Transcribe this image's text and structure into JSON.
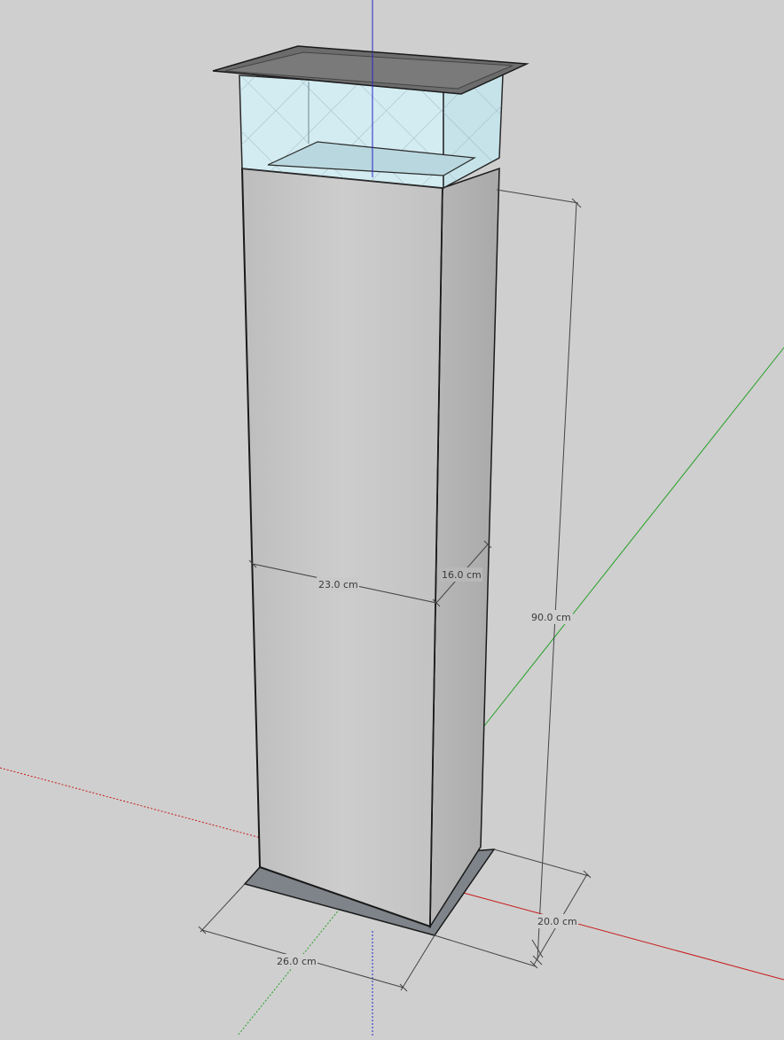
{
  "scene": {
    "background": "#cfcfcf",
    "axis_colors": {
      "x": "#cc1111",
      "y": "#22aa22",
      "z": "#2222cc"
    },
    "materials": {
      "pillar_front": "#c8c8c8",
      "pillar_side": "#b2b2b2",
      "base_plate": "#7c8287",
      "cap_plate": "#6e6e6e",
      "glass": "#cfeaf0",
      "edge": "#1a1a1a"
    }
  },
  "dimensions": {
    "height": "90.0 cm",
    "width_mid": "23.0 cm",
    "depth_mid": "16.0 cm",
    "base_width": "26.0 cm",
    "base_depth": "20.0 cm"
  }
}
